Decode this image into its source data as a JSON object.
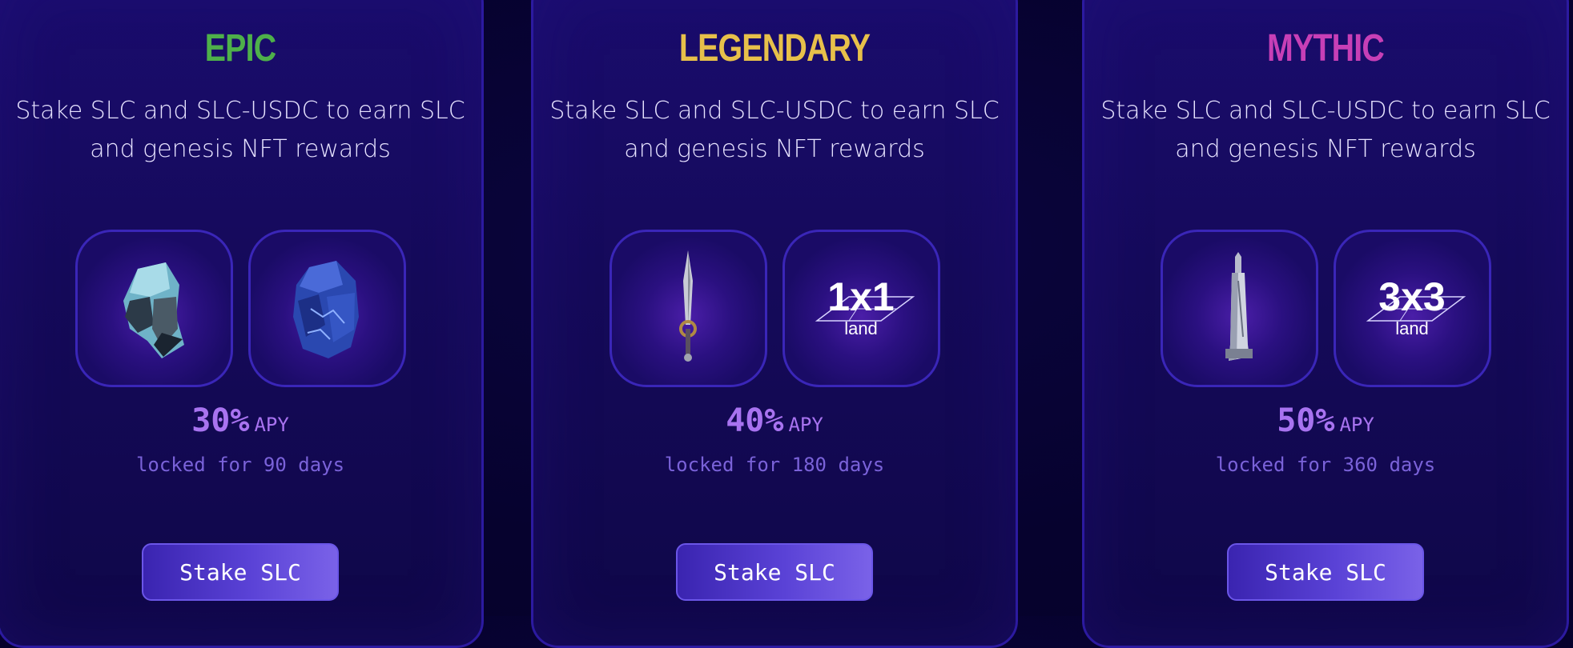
{
  "cards": [
    {
      "tier": "EPIC",
      "tier_color": "#4eb04a",
      "description": "Stake SLC and SLC-USDC to earn SLC and genesis NFT rewards",
      "rewards": [
        "crystal-rock-icon",
        "blue-ore-icon"
      ],
      "apy_value": "30%",
      "apy_label": "APY",
      "lock_text": "locked for 90 days",
      "button_label": "Stake SLC"
    },
    {
      "tier": "LEGENDARY",
      "tier_color": "#e7c04a",
      "description": "Stake SLC and SLC-USDC to earn SLC and genesis NFT rewards",
      "rewards": [
        "sword-icon",
        "land-plot-icon"
      ],
      "land_size": "1x1",
      "land_label": "land",
      "apy_value": "40%",
      "apy_label": "APY",
      "lock_text": "locked for 180 days",
      "button_label": "Stake SLC"
    },
    {
      "tier": "MYTHIC",
      "tier_color": "#c73fb6",
      "description": "Stake SLC and SLC-USDC to earn SLC and genesis NFT rewards",
      "rewards": [
        "tower-icon",
        "land-plot-icon"
      ],
      "land_size": "3x3",
      "land_label": "land",
      "apy_value": "50%",
      "apy_label": "APY",
      "lock_text": "locked for 360 days",
      "button_label": "Stake SLC"
    }
  ]
}
